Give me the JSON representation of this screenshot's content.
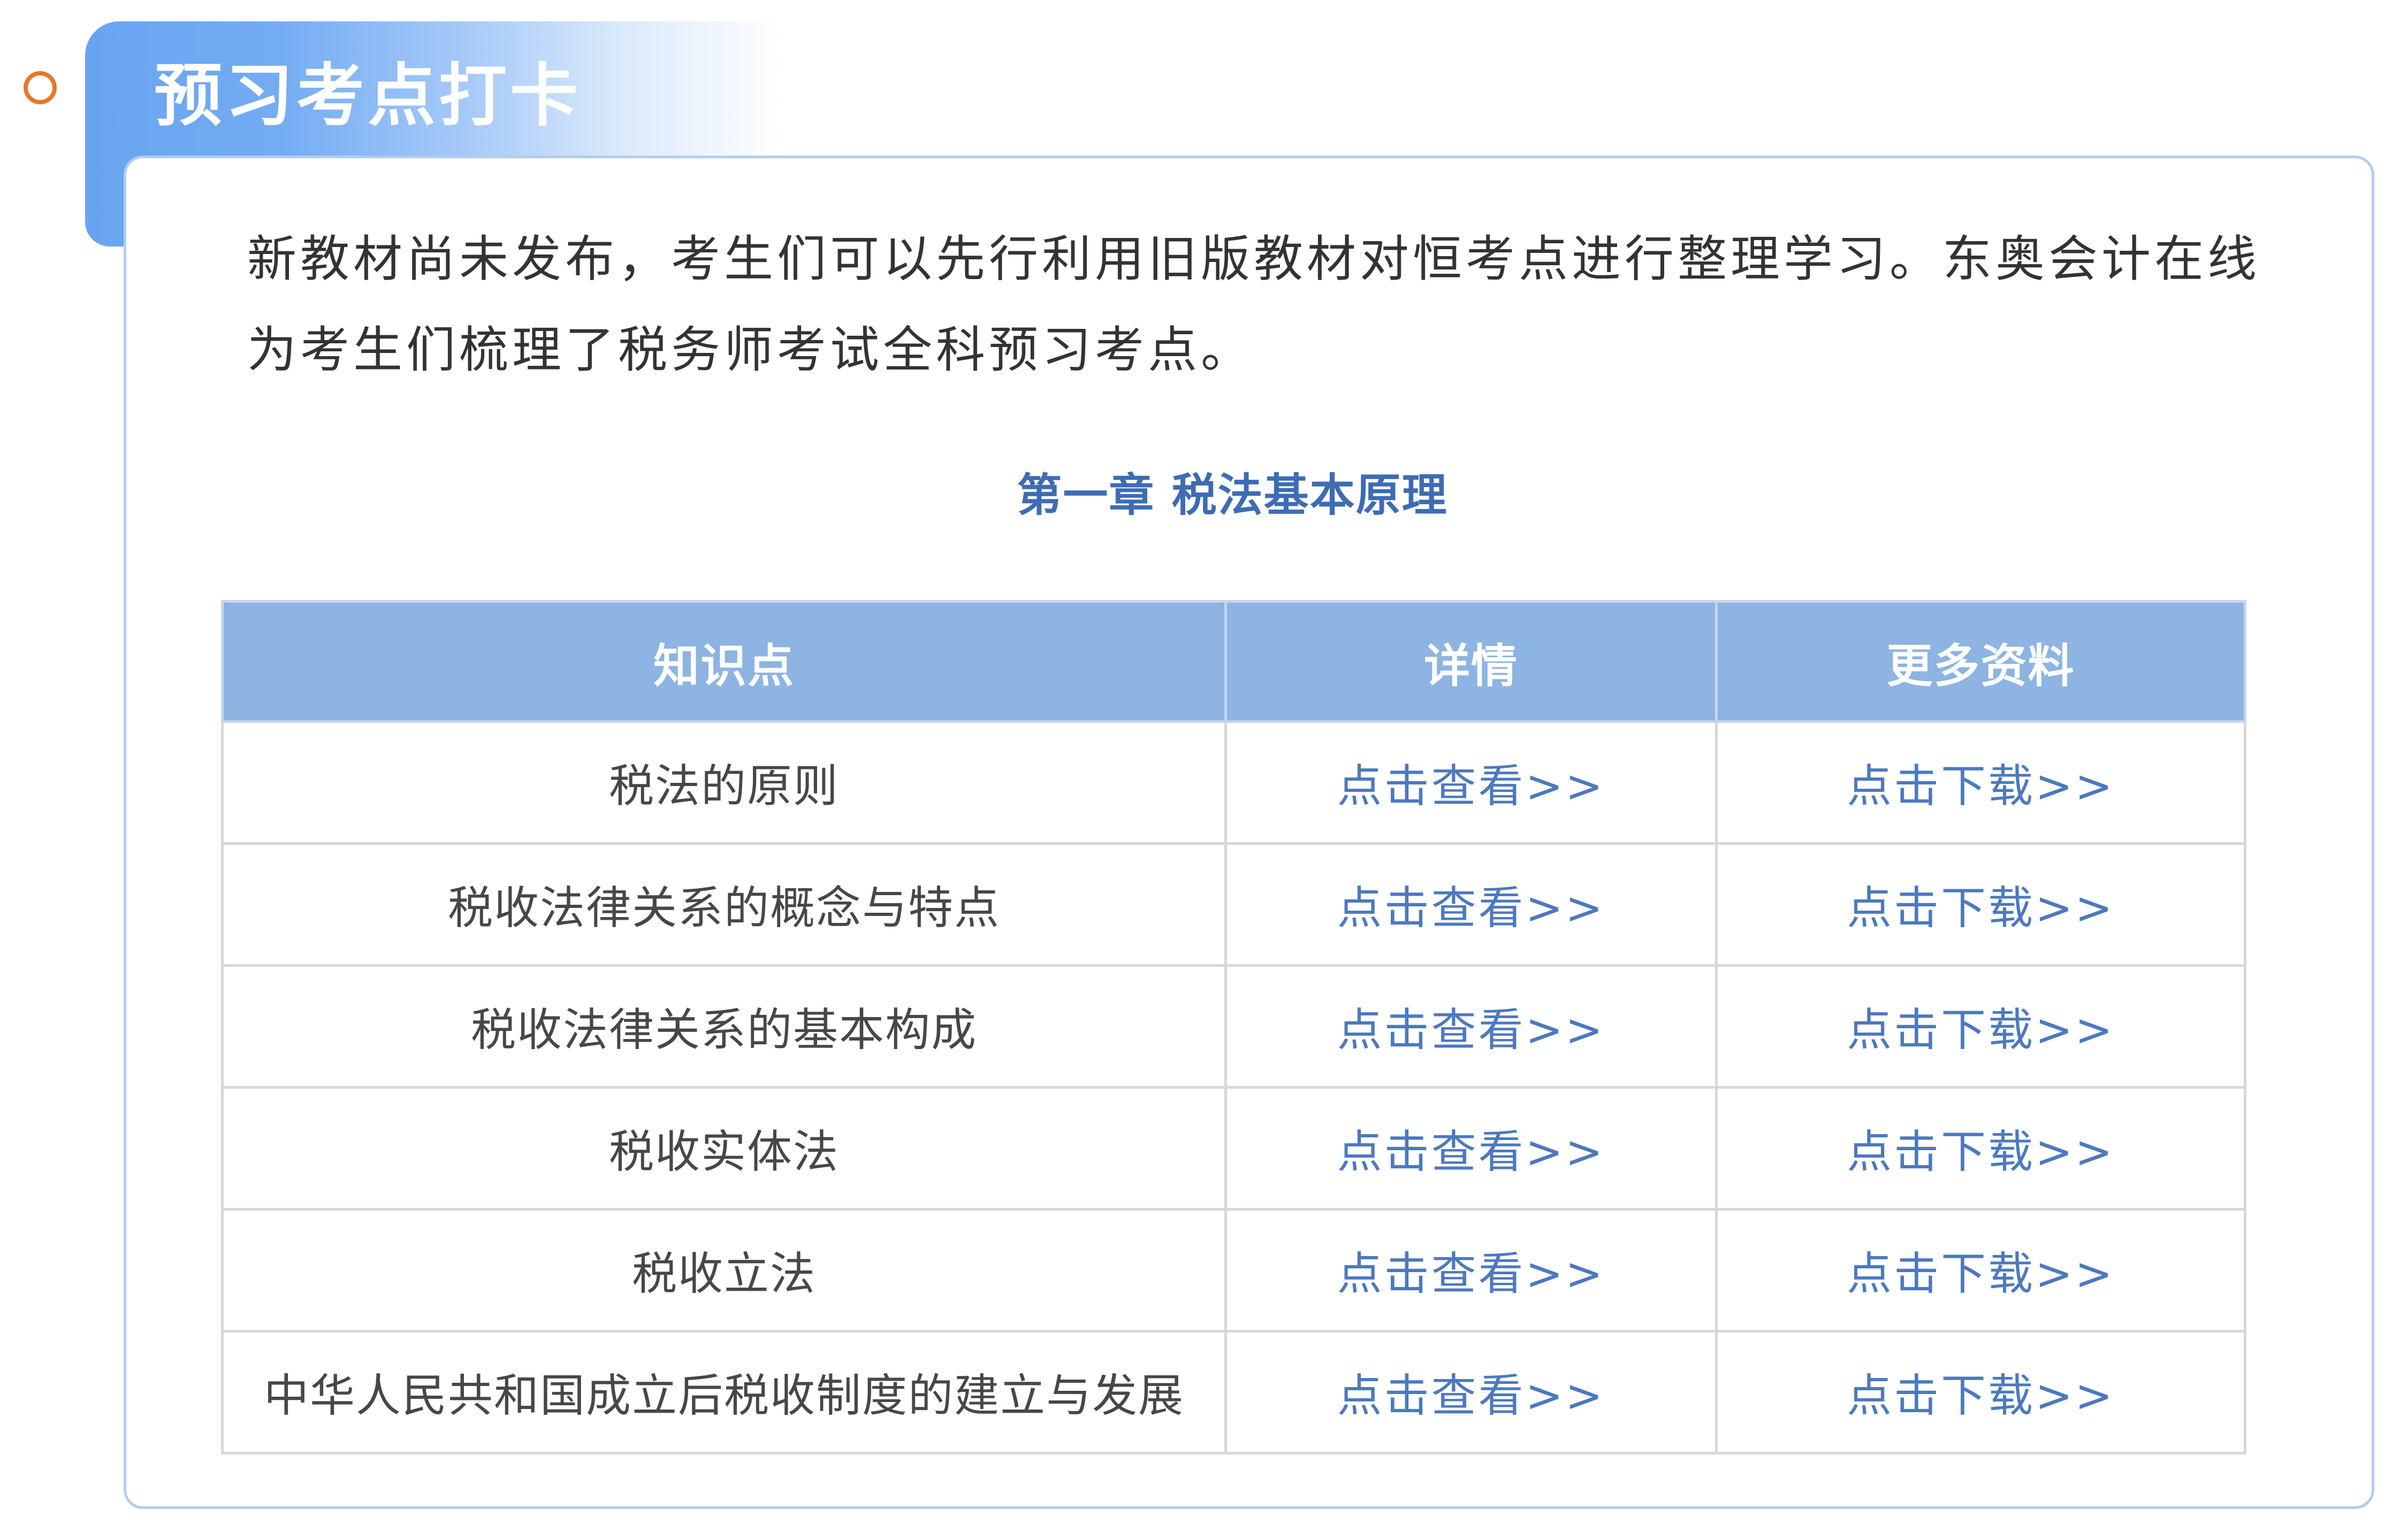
{
  "section_tab": {
    "title": "预习考点打卡"
  },
  "icons": {
    "section_marker": "circle-outline-icon"
  },
  "intro": {
    "text": "新教材尚未发布，考生们可以先行利用旧版教材对恒考点进行整理学习。东奥会计在线为考生们梳理了税务师考试全科预习考点。"
  },
  "chapter": {
    "title": "第一章 税法基本原理"
  },
  "table": {
    "headers": [
      "知识点",
      "详情",
      "更多资料"
    ],
    "rows": [
      {
        "topic": "税法的原则",
        "detail_link": "点击查看>>",
        "download_link": "点击下载>>"
      },
      {
        "topic": "税收法律关系的概念与特点",
        "detail_link": "点击查看>>",
        "download_link": "点击下载>>"
      },
      {
        "topic": "税收法律关系的基本构成",
        "detail_link": "点击查看>>",
        "download_link": "点击下载>>"
      },
      {
        "topic": "税收实体法",
        "detail_link": "点击查看>>",
        "download_link": "点击下载>>"
      },
      {
        "topic": "税收立法",
        "detail_link": "点击查看>>",
        "download_link": "点击下载>>"
      },
      {
        "topic": "中华人民共和国成立后税收制度的建立与发展",
        "detail_link": "点击查看>>",
        "download_link": "点击下载>>"
      }
    ]
  },
  "colors": {
    "accent_orange": "#E8782A",
    "tab_blue": "#68A4F1",
    "card_border": "#B3CDEE",
    "chapter_title": "#3D6CB4",
    "table_header_bg": "#8DB4E2",
    "link_blue": "#4C79BF",
    "body_text": "#333333"
  }
}
